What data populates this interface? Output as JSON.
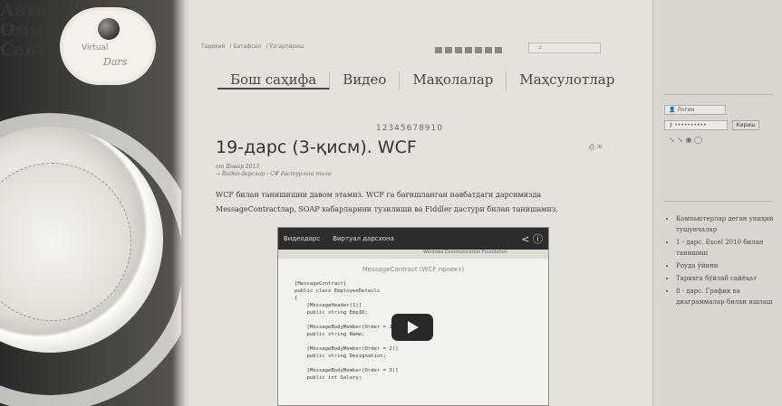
{
  "logo": {
    "line1": "Virtual",
    "line2": "Dars"
  },
  "breadcrumb": [
    "Тарихий",
    "Батафсил",
    "Ўзгартириш"
  ],
  "nav": {
    "items": [
      "Бош саҳифа",
      "Видео",
      "Мақолалар",
      "Маҳсулотлар"
    ]
  },
  "pager": "12345678910",
  "article": {
    "title": "19-дарс (3-қисм). WCF",
    "date": "от Январ 2013",
    "meta": "→ Видео-дарслар › C# дастурлаш тили",
    "text": "WCF билан танишишни давом этамиз. WCF га бағишланган навбатдаги дарсимизда MessageContractлар, SOAP хабарларини тузилиши ва Fiddler дастури билан танишамиз."
  },
  "video": {
    "top_left": "Видеодарс",
    "title": "Виртуал дарсхона",
    "subtitle": "Windows Communication Foundation",
    "heading": "MessageContract (WCF проект)",
    "code": "[MessageContract]\npublic class EmployeeDetails\n{\n    [MessageHeader(1)]\n    public string EmpID;\n\n    [MessageBodyMember(Order = 1)]\n    public string Name;\n\n    [MessageBodyMember(Order = 2)]\n    public string Designation;\n\n    [MessageBodyMember(Order = 3)]\n    public int Salary;"
  },
  "sidebar": {
    "auth_title": "Авторизация",
    "login_placeholder": "Логин",
    "password_value": "••••••••••",
    "login_button": "Кириш",
    "popular_title": "Оммабоп",
    "popular_items": [
      "Компьютерлар деган униҳий тушунчалар",
      "1 - дарс. Excel 2010 билан танишиш",
      "Роуда ўйини",
      "Тарихга бўйлаб сайёҳат",
      "8 - дарс. График ва диаграммалар билан ишлаш"
    ],
    "site_title": "Сайтда"
  }
}
